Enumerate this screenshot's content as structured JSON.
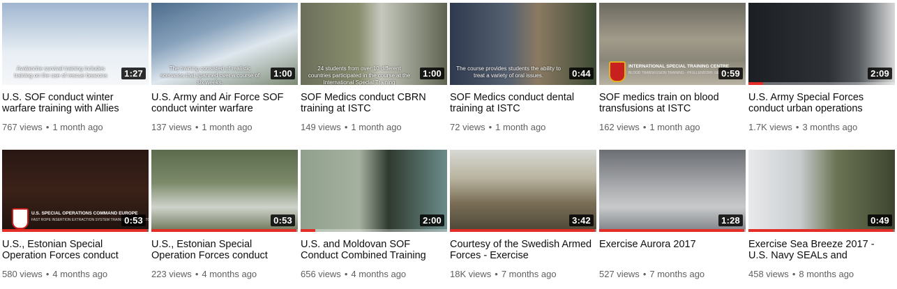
{
  "videos": [
    {
      "title": "U.S. SOF conduct winter warfare training with Allies",
      "views": "767 views",
      "age": "1 month ago",
      "duration": "1:27",
      "caption": "Avalanche survival training includes training on the use of rescue beacons",
      "progress": 0
    },
    {
      "title": "U.S. Army and Air Force SOF conduct winter warfare",
      "views": "137 views",
      "age": "1 month ago",
      "duration": "1:00",
      "caption": "The training consisted of realistic scenarios that spanned over a course of six weeks.",
      "progress": 0
    },
    {
      "title": "SOF Medics conduct CBRN training at ISTC",
      "views": "149 views",
      "age": "1 month ago",
      "duration": "1:00",
      "caption": "24 students from over 10 different countries participated in the course at the International Special Training",
      "progress": 0
    },
    {
      "title": "SOF Medics conduct dental training at ISTC",
      "views": "72 views",
      "age": "1 month ago",
      "duration": "0:44",
      "caption": "The course provides students the ability to treat a variety of oral issues.",
      "progress": 0
    },
    {
      "title": "SOF medics train on blood transfusions at ISTC",
      "views": "162 views",
      "age": "1 month ago",
      "duration": "0:59",
      "caption": "INTERNATIONAL SPECIAL TRAINING CENTRE",
      "subcaption": "BLOOD TRANSFUSION TRAINING - PFULLENDORF, GERMANY",
      "progress": 0
    },
    {
      "title": "U.S. Army Special Forces conduct urban operations",
      "views": "1.7K views",
      "age": "3 months ago",
      "duration": "2:09",
      "caption": "",
      "progress": 0.1
    },
    {
      "title": "U.S., Estonian Special Operation Forces conduct",
      "views": "580 views",
      "age": "4 months ago",
      "duration": "0:53",
      "caption": "U.S. SPECIAL OPERATIONS COMMAND EUROPE",
      "subcaption": "FAST ROPE INSERTION EXTRACTION SYSTEM TRAINING - TAPA, ESTONIA",
      "progress": 0.99
    },
    {
      "title": "U.S., Estonian Special Operation Forces conduct",
      "views": "223 views",
      "age": "4 months ago",
      "duration": "0:53",
      "caption": "",
      "progress": 0.99
    },
    {
      "title": "U.S. and Moldovan SOF Conduct Combined Training",
      "views": "656 views",
      "age": "4 months ago",
      "duration": "2:00",
      "caption": "",
      "progress": 0.1
    },
    {
      "title": "Courtesy of the Swedish Armed Forces - Exercise",
      "views": "18K views",
      "age": "7 months ago",
      "duration": "3:42",
      "caption": "",
      "progress": 0.99
    },
    {
      "title": "Exercise Aurora 2017",
      "views": "527 views",
      "age": "7 months ago",
      "duration": "1:28",
      "caption": "",
      "progress": 0.99
    },
    {
      "title": "Exercise Sea Breeze 2017 - U.S. Navy SEALs and",
      "views": "458 views",
      "age": "8 months ago",
      "duration": "0:49",
      "caption": "",
      "progress": 0.99
    }
  ],
  "meta_separator": "•",
  "colors": {
    "progress": "#e52d27",
    "meta": "#606060",
    "title": "#0d0d0d"
  }
}
